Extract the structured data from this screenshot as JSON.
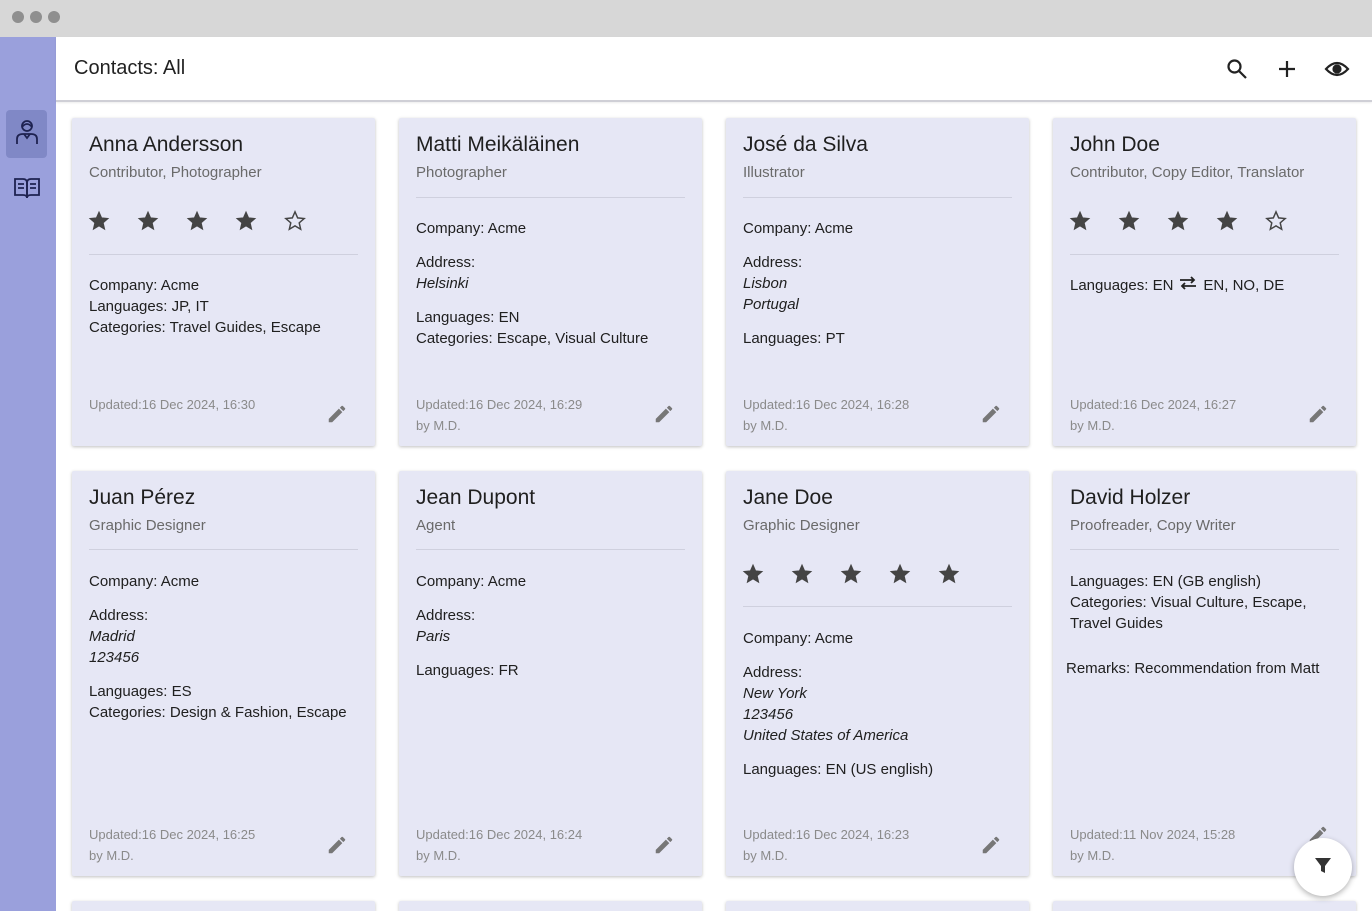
{
  "app": {
    "page_title": "Contacts: All"
  },
  "toolbar": {
    "search_icon": "search-icon",
    "add_icon": "plus-icon",
    "view_icon": "eye-icon"
  },
  "sidebar": {
    "items": [
      {
        "icon": "person-icon",
        "active": true
      },
      {
        "icon": "book-icon",
        "active": false
      }
    ]
  },
  "contacts": [
    {
      "name": "Anna Andersson",
      "roles": "Contributor, Photographer",
      "rating": 4,
      "company": "Company: Acme",
      "languages": "Languages: JP, IT",
      "categories": "Categories: Travel Guides, Escape",
      "updated": "Updated:16 Dec 2024, 16:30"
    },
    {
      "name": "Matti Meikäläinen",
      "roles": "Photographer",
      "company": "Company: Acme",
      "address_label": "Address:",
      "address_lines": [
        "Helsinki"
      ],
      "languages": "Languages: EN",
      "categories": "Categories: Escape, Visual Culture",
      "updated": "Updated:16 Dec 2024, 16:29",
      "by": "by M.D."
    },
    {
      "name": "José da Silva",
      "roles": "Illustrator",
      "company": "Company: Acme",
      "address_label": "Address:",
      "address_lines": [
        "Lisbon",
        "Portugal"
      ],
      "languages": "Languages: PT",
      "updated": "Updated:16 Dec 2024, 16:28",
      "by": "by M.D."
    },
    {
      "name": "John Doe",
      "roles": "Contributor, Copy Editor, Translator",
      "rating": 4,
      "languages_from": "Languages: EN",
      "languages_to": "EN, NO, DE",
      "updated": "Updated:16 Dec 2024, 16:27",
      "by": "by M.D."
    },
    {
      "name": "Juan Pérez",
      "roles": "Graphic Designer",
      "company": "Company: Acme",
      "address_label": "Address:",
      "address_lines": [
        "Madrid",
        "123456"
      ],
      "languages": "Languages: ES",
      "categories": "Categories: Design & Fashion, Escape",
      "updated": "Updated:16 Dec 2024, 16:25",
      "by": "by M.D."
    },
    {
      "name": "Jean Dupont",
      "roles": "Agent",
      "company": "Company: Acme",
      "address_label": "Address:",
      "address_lines": [
        "Paris"
      ],
      "languages": "Languages: FR",
      "updated": "Updated:16 Dec 2024, 16:24",
      "by": "by M.D."
    },
    {
      "name": "Jane Doe",
      "roles": "Graphic Designer",
      "rating": 5,
      "company": "Company: Acme",
      "address_label": "Address:",
      "address_lines": [
        "New York",
        "123456",
        "United States of America"
      ],
      "languages": "Languages: EN (US english)",
      "updated": "Updated:16 Dec 2024, 16:23",
      "by": "by M.D."
    },
    {
      "name": "David Holzer",
      "roles": "Proofreader, Copy Writer",
      "languages": "Languages: EN (GB english)",
      "categories": "Categories: Visual Culture, Escape, Travel Guides",
      "remarks": "Remarks: Recommendation from Matt",
      "updated": "Updated:11 Nov 2024, 15:28",
      "by": "by M.D."
    }
  ],
  "colors": {
    "sidebar": "#9aa0dc",
    "card": "#e6e7f5",
    "titlebar": "#d7d7d7"
  },
  "fab": {
    "icon": "filter-icon"
  }
}
